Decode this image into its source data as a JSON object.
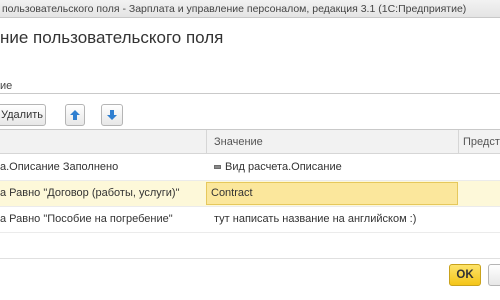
{
  "window": {
    "title": "пользовательского поля - Зарплата и управление персоналом, редакция 3.1  (1С:Предприятие)"
  },
  "dialog": {
    "heading": "ние пользовательского поля",
    "field_label": "ие"
  },
  "toolbar": {
    "delete_label": "Удалить",
    "up_icon": "arrow-up-icon",
    "down_icon": "arrow-down-icon"
  },
  "table": {
    "columns": [
      "",
      "Значение",
      "Предст"
    ],
    "rows": [
      {
        "condition": "а.Описание Заполнено",
        "value": "Вид расчета.Описание",
        "value_icon": "attribute-icon"
      },
      {
        "condition": "а Равно \"Договор (работы, услуги)\"",
        "value": "Contract"
      },
      {
        "condition": "а Равно \"Пособие на погребение\"",
        "value": "тут написать название на английском :)"
      }
    ]
  },
  "footer": {
    "ok_label": "OK"
  },
  "colors": {
    "ok_button": "#f4c518",
    "selected_row": "#fdf8d9",
    "edit_cell": "#fbe79c"
  }
}
